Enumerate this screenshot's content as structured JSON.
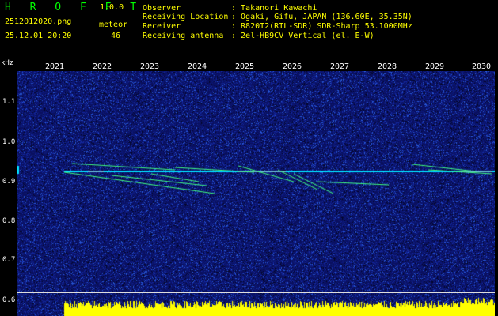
{
  "app": {
    "title": "H R O F F T",
    "version": "1.0.0",
    "filename": "2512012020.png",
    "datetime": "25.12.01 20:20",
    "meteor_label": "meteor",
    "meteor_count": "46"
  },
  "info": {
    "rows": [
      {
        "label": "Observer",
        "value": ": Takanori Kawachi"
      },
      {
        "label": "Receiving Location",
        "value": ": Ogaki, Gifu, JAPAN (136.60E, 35.35N)"
      },
      {
        "label": "Receiver",
        "value": ": R820T2(RTL-SDR) SDR-Sharp 53.1000MHz"
      },
      {
        "label": "Receiving antenna",
        "value": ": 2el-HB9CV Vertical (el. E-W)"
      }
    ]
  },
  "y_axis": {
    "unit": "kHz",
    "ticks": [
      "1.1",
      "1.0",
      "0.9",
      "0.8",
      "0.7",
      "0.6"
    ]
  },
  "x_axis": {
    "ticks": [
      "2021",
      "2022",
      "2023",
      "2024",
      "2025",
      "2026",
      "2027",
      "2028",
      "2029",
      "2030"
    ]
  },
  "colors": {
    "background": "#000000",
    "spectrogram_bg": "#0a1060",
    "carrier": "#00e0ff",
    "meteor": "#40ff80",
    "power_bar": "#ffff00"
  }
}
